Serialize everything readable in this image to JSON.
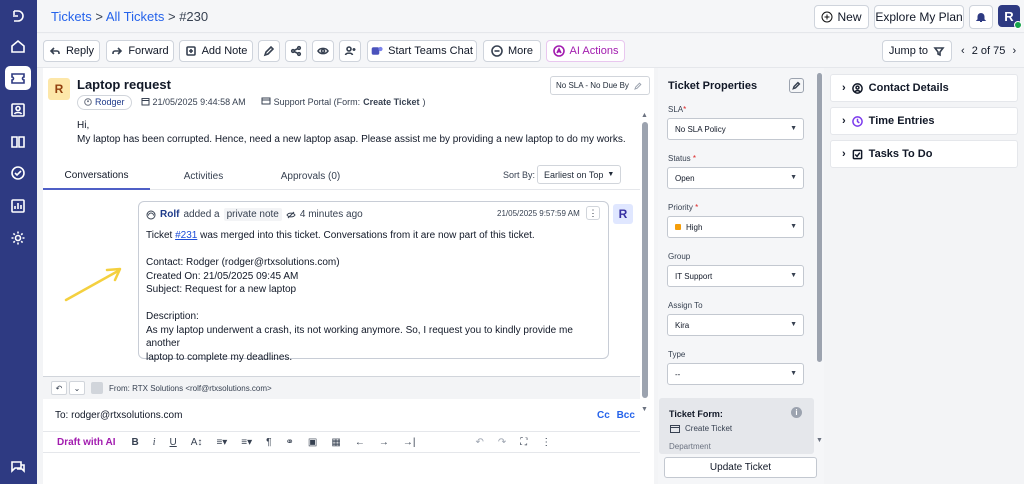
{
  "nav": {
    "items": [
      "logo-icon",
      "home-icon",
      "tickets-icon",
      "contacts-icon",
      "knowledge-icon",
      "tasks-icon",
      "reports-icon",
      "settings-icon",
      "chat-icon"
    ]
  },
  "header": {
    "breadcrumb_root": "Tickets",
    "breadcrumb_sep1": ">",
    "breadcrumb_all": "All Tickets",
    "breadcrumb_sep2": ">",
    "breadcrumb_id": "#230",
    "new_label": "New",
    "plan_label": "Explore My Plan",
    "user_initial": "R"
  },
  "toolbar": {
    "reply": "Reply",
    "forward": "Forward",
    "add_note": "Add Note",
    "teams": "Start Teams Chat",
    "more": "More",
    "ai": "AI Actions",
    "jump": "Jump to",
    "pager": "2 of 75"
  },
  "ticket": {
    "avatar": "R",
    "title": "Laptop request",
    "requester": "Rodger",
    "created": "21/05/2025 9:44:58 AM",
    "source": "Support Portal (Form: ",
    "source_form": "Create Ticket",
    "source_end": ")",
    "sla": "No SLA - No Due By",
    "greeting": "Hi,",
    "body": "My laptop has been corrupted. Hence, need a new laptop asap. Please assist me by providing a new laptop to do my works."
  },
  "tabs": {
    "conversations": "Conversations",
    "activities": "Activities",
    "approvals": "Approvals (0)",
    "sort_label": "Sort By:",
    "sort_value": "Earliest on Top"
  },
  "note": {
    "author": "Rolf",
    "action": "added a",
    "type": "private note",
    "ago": "4 minutes ago",
    "timestamp": "21/05/2025 9:57:59 AM",
    "avatar": "R",
    "line1_a": "Ticket ",
    "line1_link": "#231",
    "line1_b": " was merged into this ticket. Conversations from it are now part of this ticket.",
    "contact": "Contact: Rodger (rodger@rtxsolutions.com)",
    "created": "Created On: 21/05/2025 09:45 AM",
    "subject": "Subject: Request for a new laptop",
    "desc_label": "Description:",
    "desc1": "As my laptop underwent a crash, its not working anymore. So, I request you to kindly provide me another",
    "desc2": "laptop to complete my deadlines."
  },
  "reply": {
    "from": "From:  RTX Solutions <rolf@rtxsolutions.com>",
    "to": "To: rodger@rtxsolutions.com",
    "cc": "Cc",
    "bcc": "Bcc",
    "draft": "Draft with AI"
  },
  "props": {
    "title": "Ticket Properties",
    "sla_label": "SLA",
    "sla_value": "No SLA Policy",
    "status_label": "Status",
    "status_value": "Open",
    "priority_label": "Priority",
    "priority_value": "High",
    "group_label": "Group",
    "group_value": "IT Support",
    "assign_label": "Assign To",
    "assign_value": "Kira",
    "type_label": "Type",
    "type_value": "--",
    "form_label": "Ticket Form:",
    "form_value": "Create Ticket",
    "dept_label": "Department",
    "update": "Update Ticket",
    "req_mark": "*"
  },
  "right": {
    "contact": "Contact Details",
    "time": "Time Entries",
    "todo": "Tasks To Do"
  },
  "colors": {
    "nav": "#2e3a82",
    "accent": "#4f5fc6",
    "ai": "#a21caf",
    "link": "#2563eb",
    "arrow": "#f4d03f"
  }
}
